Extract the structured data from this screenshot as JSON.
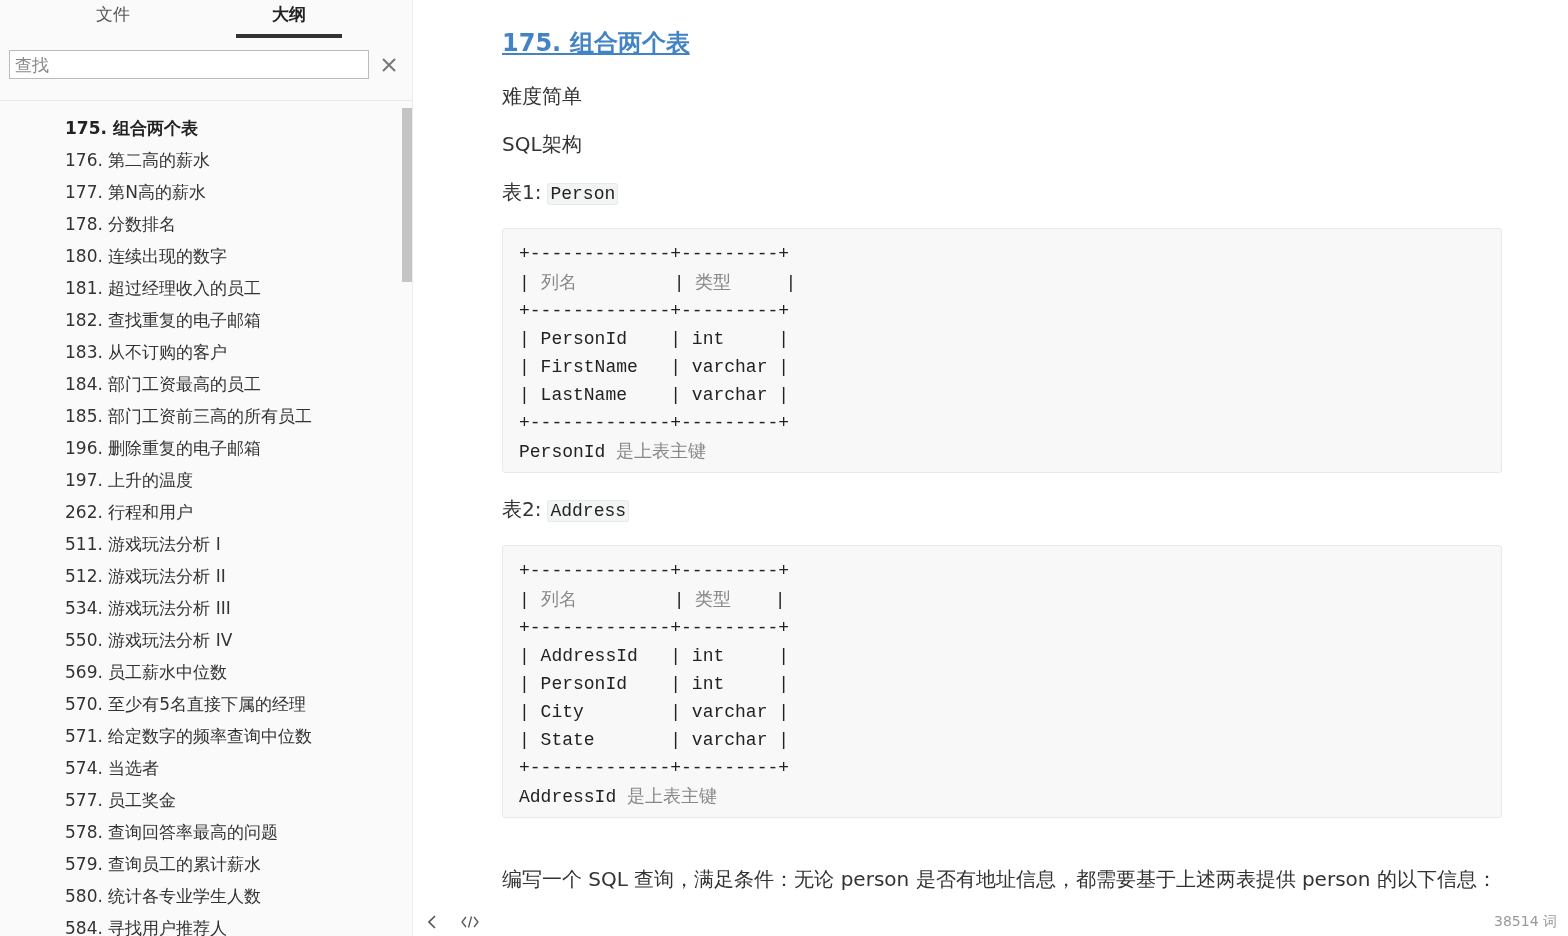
{
  "sidebar": {
    "tabs": [
      {
        "label": "文件",
        "selected": false
      },
      {
        "label": "大纲",
        "selected": true
      }
    ],
    "search": {
      "placeholder": "查找"
    },
    "outline": [
      {
        "label": "175. 组合两个表",
        "selected": true
      },
      {
        "label": "176. 第二高的薪水",
        "selected": false
      },
      {
        "label": "177. 第N高的薪水",
        "selected": false
      },
      {
        "label": "178. 分数排名",
        "selected": false
      },
      {
        "label": "180. 连续出现的数字",
        "selected": false
      },
      {
        "label": "181. 超过经理收入的员工",
        "selected": false
      },
      {
        "label": "182. 查找重复的电子邮箱",
        "selected": false
      },
      {
        "label": "183. 从不订购的客户",
        "selected": false
      },
      {
        "label": "184. 部门工资最高的员工",
        "selected": false
      },
      {
        "label": "185. 部门工资前三高的所有员工",
        "selected": false
      },
      {
        "label": "196. 删除重复的电子邮箱",
        "selected": false
      },
      {
        "label": "197. 上升的温度",
        "selected": false
      },
      {
        "label": "262. 行程和用户",
        "selected": false
      },
      {
        "label": "511. 游戏玩法分析 I",
        "selected": false
      },
      {
        "label": "512. 游戏玩法分析 II",
        "selected": false
      },
      {
        "label": "534. 游戏玩法分析 III",
        "selected": false
      },
      {
        "label": "550. 游戏玩法分析 IV",
        "selected": false
      },
      {
        "label": "569. 员工薪水中位数",
        "selected": false
      },
      {
        "label": "570. 至少有5名直接下属的经理",
        "selected": false
      },
      {
        "label": "571. 给定数字的频率查询中位数",
        "selected": false
      },
      {
        "label": "574. 当选者",
        "selected": false
      },
      {
        "label": "577. 员工奖金",
        "selected": false
      },
      {
        "label": "578. 查询回答率最高的问题",
        "selected": false
      },
      {
        "label": "579. 查询员工的累计薪水",
        "selected": false
      },
      {
        "label": "580. 统计各专业学生人数",
        "selected": false
      },
      {
        "label": "584. 寻找用户推荐人",
        "selected": false
      }
    ]
  },
  "document": {
    "title": "175. 组合两个表",
    "blocks": [
      {
        "kind": "paragraph",
        "text": "难度简单"
      },
      {
        "kind": "paragraph",
        "text": "SQL架构"
      },
      {
        "kind": "table_label",
        "text": "表1:",
        "code": "Person"
      },
      {
        "kind": "code",
        "lines": [
          "+-------------+---------+",
          "| 列名         | 类型     |",
          "+-------------+---------+",
          "| PersonId    | int     |",
          "| FirstName   | varchar |",
          "| LastName    | varchar |",
          "+-------------+---------+",
          "PersonId 是上表主键"
        ]
      },
      {
        "kind": "table_label",
        "text": "表2:",
        "code": "Address"
      },
      {
        "kind": "code",
        "lines": [
          "+-------------+---------+",
          "| 列名         | 类型    |",
          "+-------------+---------+",
          "| AddressId   | int     |",
          "| PersonId    | int     |",
          "| City        | varchar |",
          "| State       | varchar |",
          "+-------------+---------+",
          "AddressId 是上表主键"
        ]
      },
      {
        "kind": "paragraph",
        "text": "编写一个 SQL 查询，满足条件：无论 person 是否有地址信息，都需要基于上述两表提供 person 的以下信息："
      }
    ]
  },
  "status_bar": {
    "word_count": "38514 词"
  }
}
